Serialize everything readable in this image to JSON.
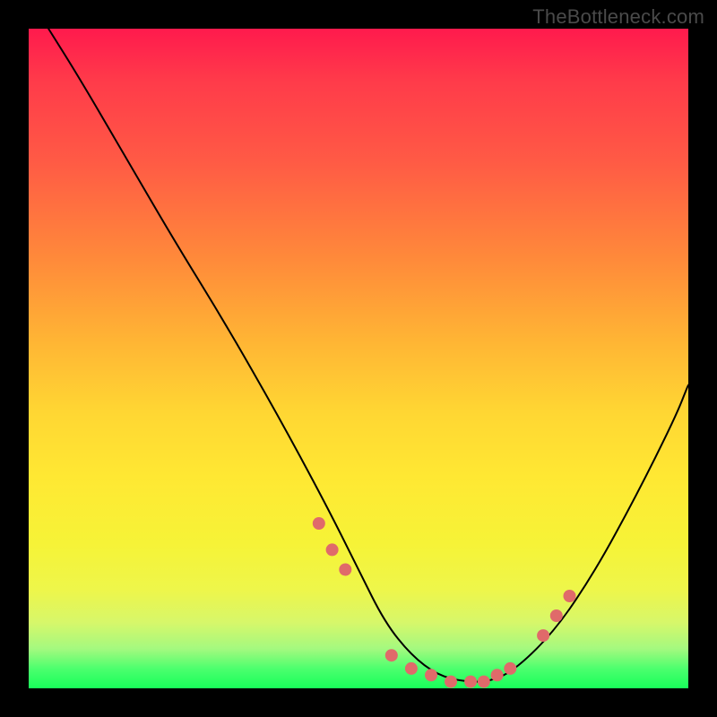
{
  "watermark": "TheBottleneck.com",
  "colors": {
    "frame": "#000000",
    "gradient_top": "#ff1a4d",
    "gradient_mid": "#ffd633",
    "gradient_bottom": "#18ff5a",
    "curve": "#000000",
    "markers": "#e06a6a"
  },
  "chart_data": {
    "type": "line",
    "title": "",
    "xlabel": "",
    "ylabel": "",
    "xlim": [
      0,
      100
    ],
    "ylim": [
      0,
      100
    ],
    "grid": false,
    "series": [
      {
        "name": "bottleneck-curve",
        "x": [
          3,
          8,
          15,
          22,
          30,
          38,
          45,
          50,
          54,
          58,
          62,
          66,
          70,
          74,
          80,
          86,
          92,
          98,
          100
        ],
        "y": [
          100,
          92,
          80,
          68,
          55,
          41,
          28,
          18,
          10,
          5,
          2,
          1,
          1,
          3,
          9,
          18,
          29,
          41,
          46
        ]
      }
    ],
    "markers": {
      "name": "highlight-points",
      "x": [
        44,
        46,
        48,
        55,
        58,
        61,
        64,
        67,
        69,
        71,
        73,
        78,
        80,
        82
      ],
      "y": [
        25,
        21,
        18,
        5,
        3,
        2,
        1,
        1,
        1,
        2,
        3,
        8,
        11,
        14
      ]
    }
  }
}
